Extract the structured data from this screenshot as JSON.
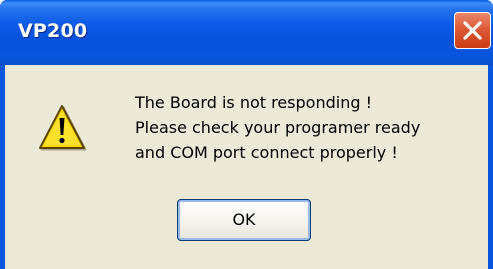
{
  "window": {
    "title": "VP200"
  },
  "titlebar": {
    "close_icon": "close-icon"
  },
  "dialog": {
    "icon": "warning-icon",
    "message_lines": [
      "The Board is not responding !",
      "Please check your programer ready",
      "and COM port connect properly !"
    ],
    "ok_label": "OK"
  },
  "colors": {
    "titlebar": "#0a55de",
    "close_button": "#dd5a36",
    "dialog_background": "#ece9d8",
    "warning_yellow": "#f8d800"
  }
}
